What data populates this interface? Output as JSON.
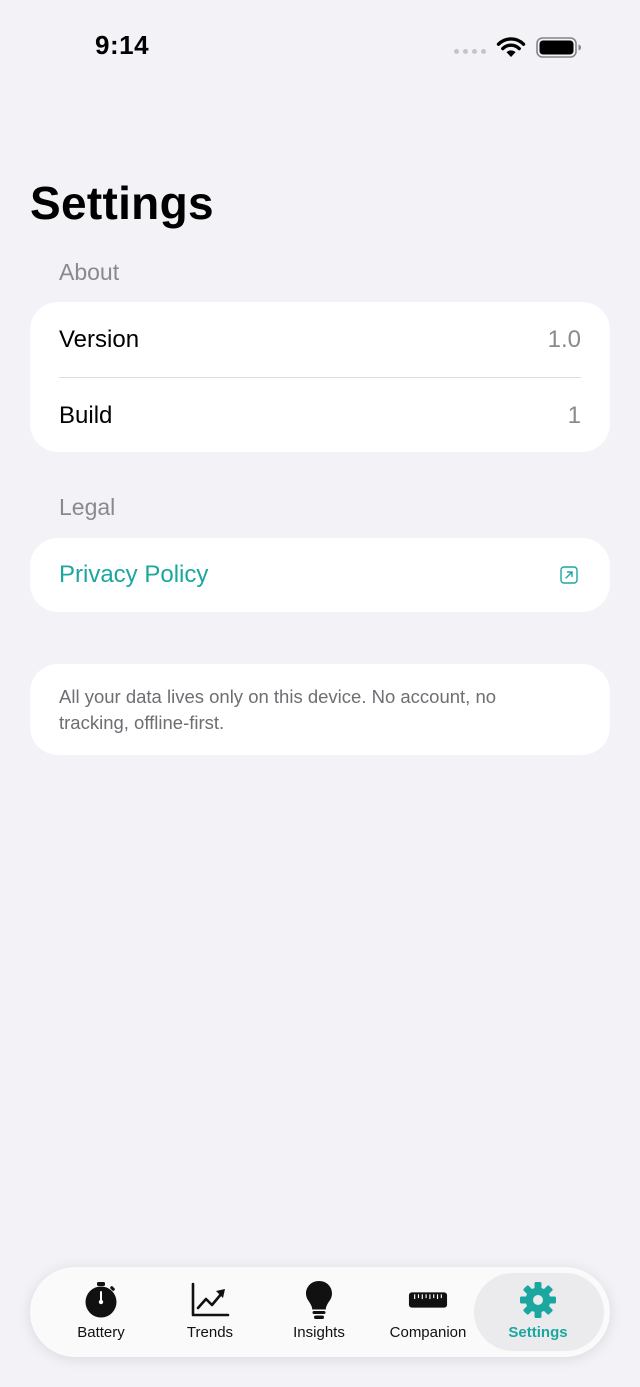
{
  "status_bar": {
    "time": "9:14"
  },
  "page_title": "Settings",
  "about": {
    "header": "About",
    "rows": [
      {
        "label": "Version",
        "value": "1.0"
      },
      {
        "label": "Build",
        "value": "1"
      }
    ]
  },
  "legal": {
    "header": "Legal",
    "privacy_label": "Privacy Policy"
  },
  "note": "All your data lives only on this device. No account, no tracking, offline-first.",
  "tabs": [
    {
      "label": "Battery",
      "icon": "stopwatch-icon"
    },
    {
      "label": "Trends",
      "icon": "chart-trend-icon"
    },
    {
      "label": "Insights",
      "icon": "lightbulb-icon"
    },
    {
      "label": "Companion",
      "icon": "ruler-icon"
    },
    {
      "label": "Settings",
      "icon": "gear-icon"
    }
  ],
  "active_tab": "Settings",
  "colors": {
    "accent": "#1ba7a0",
    "background": "#f2f2f7",
    "secondary_text": "#8a8a8e"
  }
}
